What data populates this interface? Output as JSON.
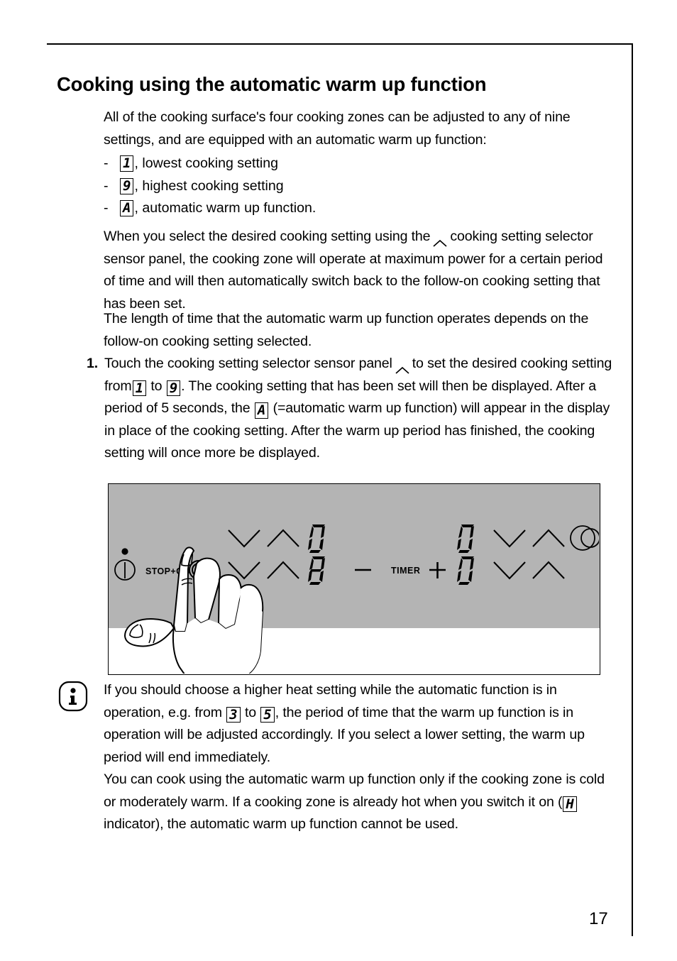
{
  "page": {
    "number": "17",
    "background_color": "#ffffff",
    "rule_color": "#000000"
  },
  "heading": {
    "title": "Cooking using the automatic warm up function"
  },
  "intro": {
    "text": "All of the cooking surface's four cooking zones can be adjusted to any of nine settings, and are equipped with an automatic warm up function:"
  },
  "settings_list": [
    {
      "dash": "-",
      "digit": "1",
      "label": ", lowest cooking setting"
    },
    {
      "dash": "-",
      "digit": "9",
      "label": ", highest cooking setting"
    },
    {
      "dash": "-",
      "digit": "A",
      "label": ", automatic warm up function."
    }
  ],
  "middle_paragraph": {
    "part1": "When you select the desired cooking setting using the",
    "icon": "chevron-up-icon",
    "part2": "cooking setting selector sensor panel, the cooking zone will operate at maximum power for a certain period of time and will then automatically switch back to the follow-on cooking setting that has been set."
  },
  "duration_paragraph": {
    "text": "The length of time that the automatic warm up function operates depends on the follow-on cooking setting selected."
  },
  "step_1": {
    "number": "1.",
    "part1": "Touch the cooking setting selector sensor panel",
    "icon": "chevron-up-icon",
    "part2": "to set the desired cooking setting from",
    "digit_from": "1",
    "part3": "to",
    "digit_to": "9",
    "part4": ". The cooking setting that has been set will then be displayed. After a period of 5 seconds, the",
    "digit_auto": "A",
    "part5": "(=automatic warm up function) will appear in the display in place of the cooking setting. After the warm up period has finished, the cooking setting will once more be displayed."
  },
  "illustration": {
    "name": "cooktop-control-panel-illustration",
    "panel_color": "#b4b4b4",
    "controls": {
      "power_icon": "power-button-icon",
      "stop_go_label": "STOP+GO",
      "lock_icon": "child-lock-icon",
      "dual_zone_icon": "dual-zone-icon",
      "timer_label": "TIMER",
      "timer_minus": "−",
      "timer_plus": "+"
    },
    "displays": {
      "rear_left": "0",
      "front_left": "8",
      "rear_right": "0",
      "front_right": "0"
    },
    "hand": "pointing-hand-illustration"
  },
  "note": {
    "icon": "info-icon",
    "paragraph1_part1": "If you should choose a higher heat setting while the automatic function is in operation, e.g. from",
    "paragraph1_digit_from": "3",
    "paragraph1_mid": "to",
    "paragraph1_digit_to": "5",
    "paragraph1_part2": ", the period of time that the warm up function is in operation will be adjusted accordingly. If you select a lower setting, the warm up period will end immediately.",
    "paragraph2_part1": "You can cook using the automatic warm up function only if the cooking zone is cold or moderately warm. If a cooking zone is already hot when you switch it on (",
    "paragraph2_digit": "H",
    "paragraph2_part2": "indicator), the automatic warm up function cannot be used."
  }
}
